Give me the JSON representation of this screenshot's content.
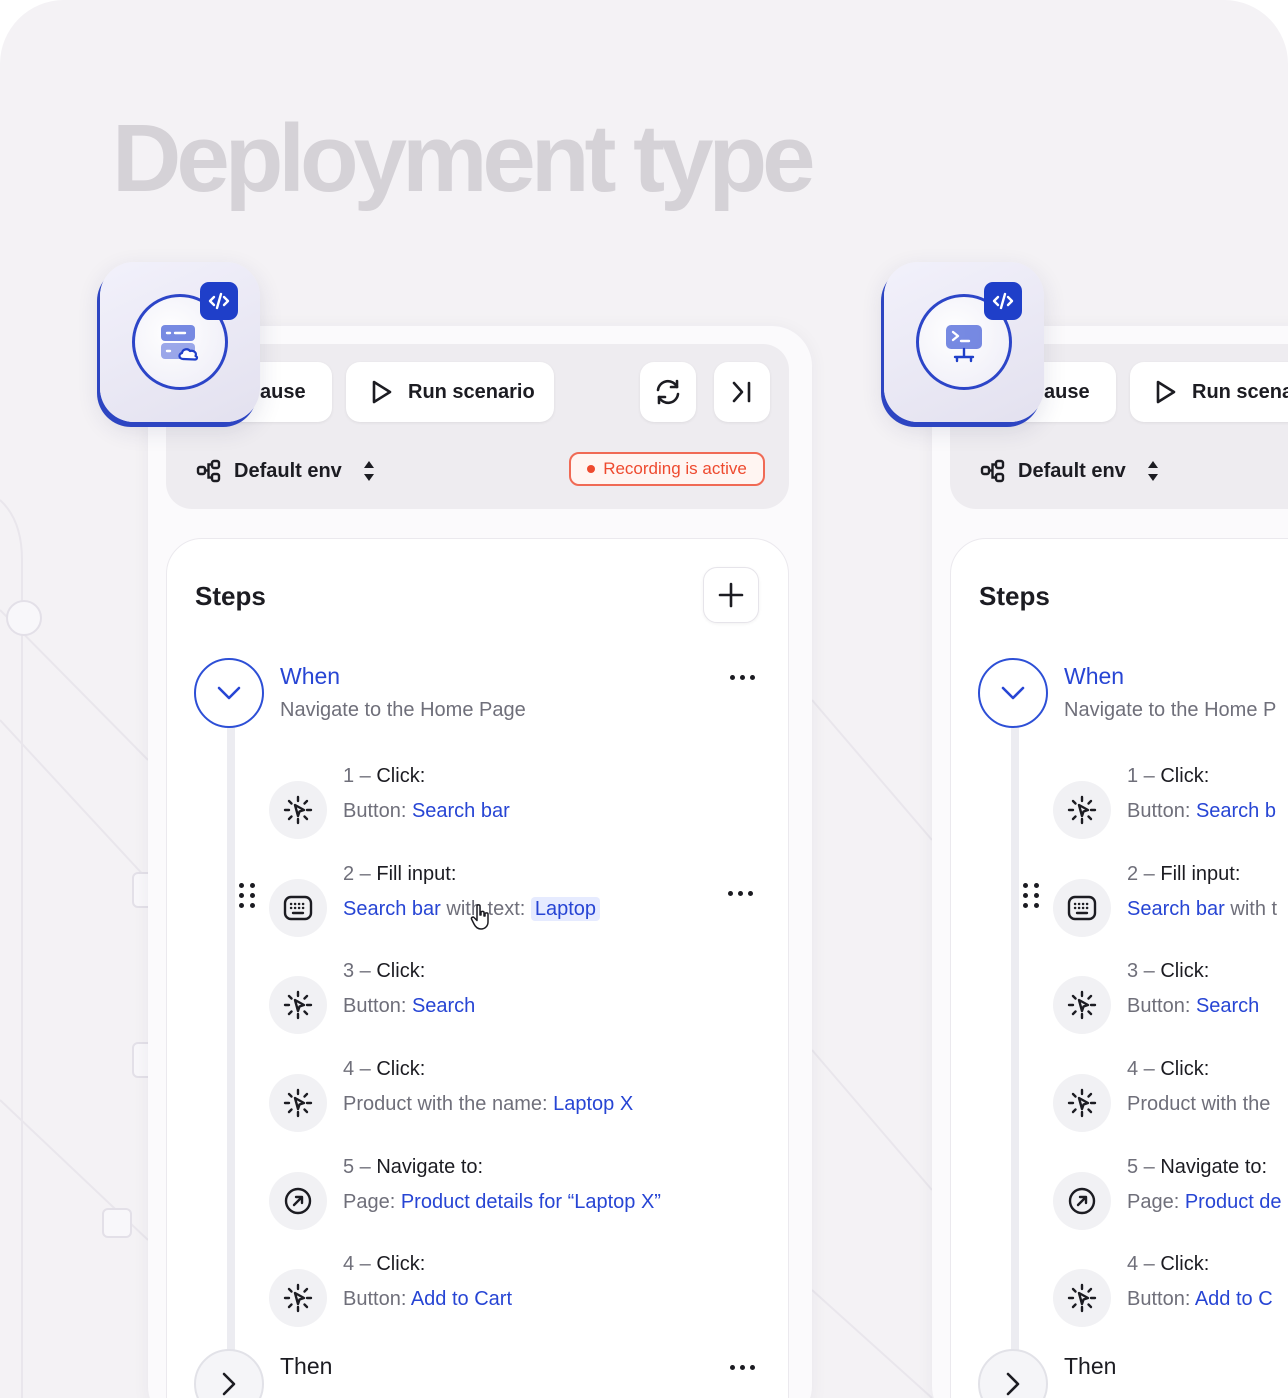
{
  "headline": "Deployment type",
  "colors": {
    "accent": "#2745d4",
    "recording": "#ee4a2f",
    "headline": "#d5d2d7"
  },
  "panels": [
    {
      "toolbar": {
        "pause_label": "ause",
        "run_label": "Run scenario",
        "env_label": "Default env",
        "recording_label": "Recording is active"
      },
      "steps": {
        "title": "Steps",
        "when": {
          "title": "When",
          "subtitle": "Navigate to the Home Page",
          "items": [
            {
              "num": "1 – ",
              "action": "Click:",
              "prefix": "Button: ",
              "target": "Search bar",
              "icon": "click-icon"
            },
            {
              "num": "2 – ",
              "action": "Fill input:",
              "link": "Search bar",
              "middle": " with text: ",
              "target": "Laptop",
              "icon": "keyboard-icon"
            },
            {
              "num": "3 – ",
              "action": "Click:",
              "prefix": "Button: ",
              "target": "Search",
              "icon": "click-icon"
            },
            {
              "num": "4 – ",
              "action": "Click:",
              "prefix": "Product with the name: ",
              "target": "Laptop X",
              "icon": "click-icon"
            },
            {
              "num": "5 – ",
              "action": "Navigate to:",
              "prefix": "Page: ",
              "target": "Product details for “Laptop X”",
              "icon": "navigate-icon"
            },
            {
              "num": "4 – ",
              "action": "Click:",
              "prefix": "Button: ",
              "target": "Add to Cart",
              "icon": "click-icon"
            }
          ]
        },
        "then": {
          "title": "Then"
        }
      }
    },
    {
      "toolbar": {
        "pause_label": "ause",
        "run_label": "Run scena",
        "env_label": "Default env"
      },
      "steps": {
        "title": "Steps",
        "when": {
          "title": "When",
          "subtitle": "Navigate to the Home P",
          "items": [
            {
              "num": "1 – ",
              "action": "Click:",
              "prefix": "Button: ",
              "target": "Search b",
              "icon": "click-icon"
            },
            {
              "num": "2 – ",
              "action": "Fill input:",
              "link": "Search bar",
              "middle": " with t",
              "icon": "keyboard-icon"
            },
            {
              "num": "3 – ",
              "action": "Click:",
              "prefix": "Button: ",
              "target": "Search",
              "icon": "click-icon"
            },
            {
              "num": "4 – ",
              "action": "Click:",
              "prefix": "Product with the",
              "icon": "click-icon"
            },
            {
              "num": "5 – ",
              "action": "Navigate to:",
              "prefix": "Page: ",
              "target": "Product de",
              "icon": "navigate-icon"
            },
            {
              "num": "4 – ",
              "action": "Click:",
              "prefix": "Button: ",
              "target": "Add to C",
              "icon": "click-icon"
            }
          ]
        },
        "then": {
          "title": "Then"
        }
      }
    }
  ],
  "deploy_badges": [
    {
      "icon": "cloud-server-icon"
    },
    {
      "icon": "desktop-terminal-icon"
    }
  ]
}
